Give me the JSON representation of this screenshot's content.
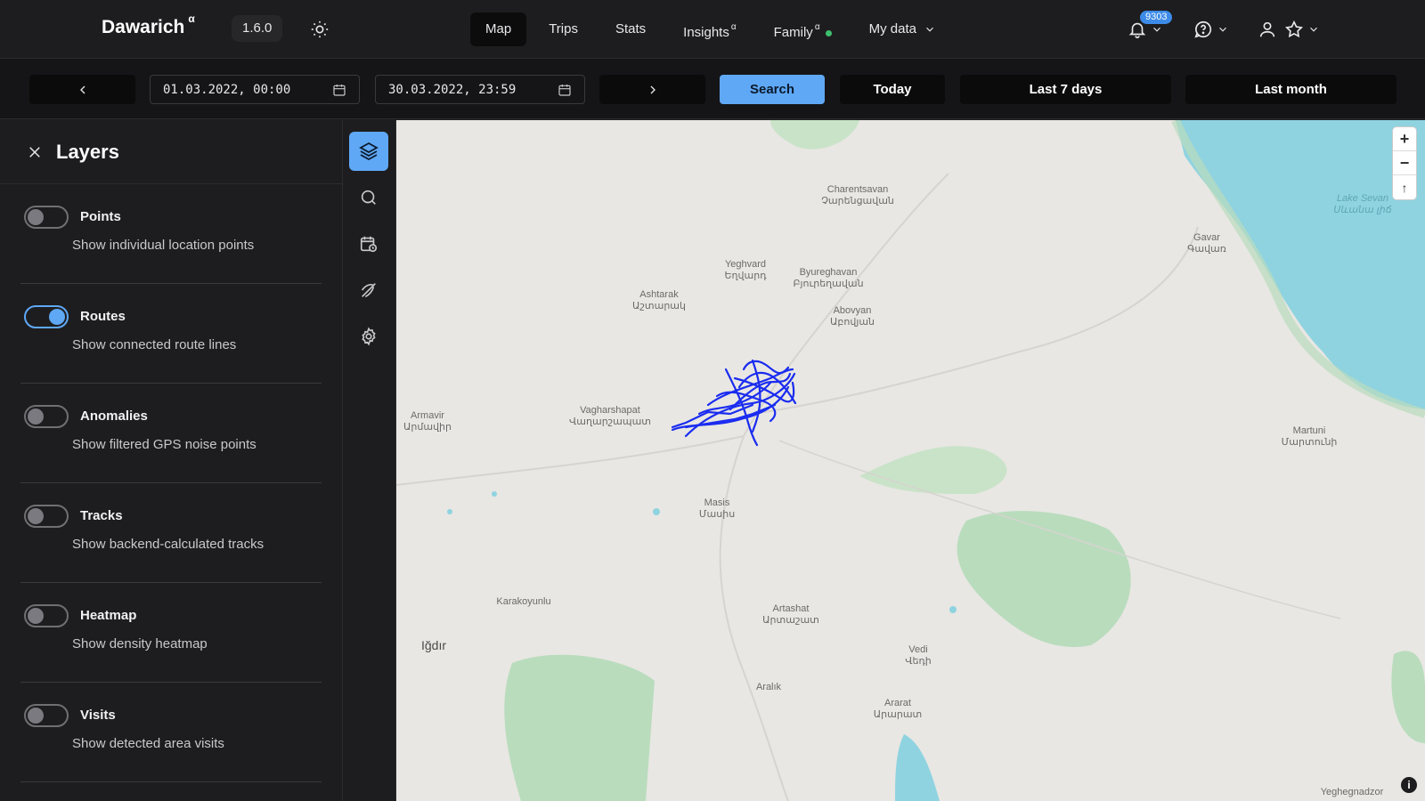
{
  "app": {
    "brand": "Dawarich",
    "brand_sup": "α",
    "version": "1.6.0"
  },
  "nav": {
    "tabs": [
      {
        "label": "Map",
        "sup": ""
      },
      {
        "label": "Trips",
        "sup": ""
      },
      {
        "label": "Stats",
        "sup": ""
      },
      {
        "label": "Insights",
        "sup": "α"
      },
      {
        "label": "Family",
        "sup": "α"
      },
      {
        "label": "My data",
        "sup": ""
      }
    ],
    "notification_count": "9303"
  },
  "toolbar": {
    "start_date": "01.03.2022, 00:00",
    "end_date": "30.03.2022, 23:59",
    "search_label": "Search",
    "today_label": "Today",
    "last7_label": "Last 7 days",
    "last_month_label": "Last month"
  },
  "layers": {
    "title": "Layers",
    "items": [
      {
        "name": "Points",
        "description": "Show individual location points",
        "enabled": false
      },
      {
        "name": "Routes",
        "description": "Show connected route lines",
        "enabled": true
      },
      {
        "name": "Anomalies",
        "description": "Show filtered GPS noise points",
        "enabled": false
      },
      {
        "name": "Tracks",
        "description": "Show backend-calculated tracks",
        "enabled": false
      },
      {
        "name": "Heatmap",
        "description": "Show density heatmap",
        "enabled": false
      },
      {
        "name": "Visits",
        "description": "Show detected area visits",
        "enabled": false
      }
    ]
  },
  "map": {
    "places": [
      {
        "name": "Charentsavan",
        "local": "Չարենցավան"
      },
      {
        "name": "Yeghvard",
        "local": "Եղվարդ"
      },
      {
        "name": "Byureghavan",
        "local": "Բյուրեղավան"
      },
      {
        "name": "Ashtarak",
        "local": "Աշտարակ"
      },
      {
        "name": "Abovyan",
        "local": "Աբովյան"
      },
      {
        "name": "Gavar",
        "local": "Գավառ"
      },
      {
        "name": "Lake Sevan",
        "local": "Սևանա լիճ"
      },
      {
        "name": "Armavir",
        "local": "Արմավիր"
      },
      {
        "name": "Vagharshapat",
        "local": "Վաղարշապատ"
      },
      {
        "name": "Martuni",
        "local": "Մարտունի"
      },
      {
        "name": "Masis",
        "local": "Մասիս"
      },
      {
        "name": "Karakoyunlu",
        "local": ""
      },
      {
        "name": "Artashat",
        "local": "Արտաշատ"
      },
      {
        "name": "Iğdır",
        "local": ""
      },
      {
        "name": "Vedi",
        "local": "Վեդի"
      },
      {
        "name": "Aralık",
        "local": ""
      },
      {
        "name": "Ararat",
        "local": "Արարատ"
      },
      {
        "name": "Yeghegnadzor",
        "local": ""
      }
    ],
    "zoom_in": "+",
    "zoom_out": "−",
    "reset_north": "↑",
    "info": "i",
    "route_color": "#1a2cf0",
    "water_color": "#8fd3e0",
    "park_color": "#b9dcbd"
  }
}
